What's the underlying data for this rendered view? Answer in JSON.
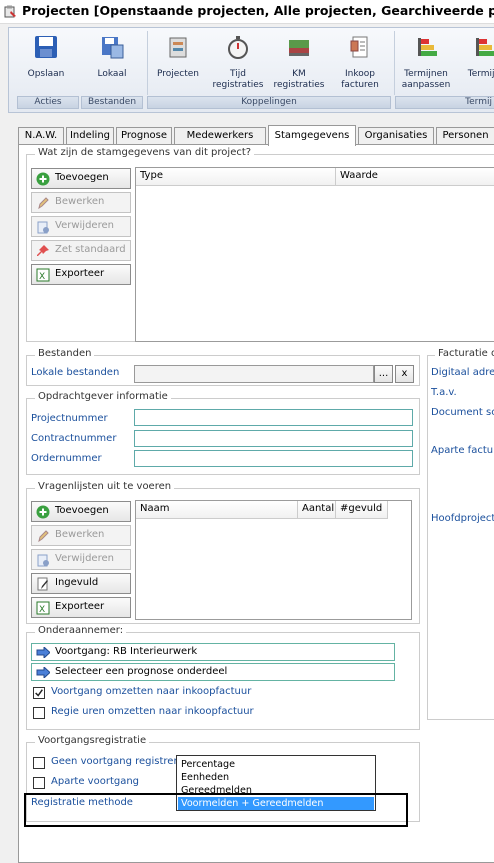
{
  "window": {
    "title": "Projecten [Openstaande projecten, Alle projecten, Gearchiveerde proje"
  },
  "ribbon": {
    "buttons": [
      {
        "label": "Opslaan",
        "icon": "floppy-disk-icon"
      },
      {
        "label": "Lokaal",
        "icon": "local-save-icon"
      },
      {
        "label": "Projecten",
        "icon": "projects-icon"
      },
      {
        "label": "Tijd registraties",
        "icon": "stopwatch-icon"
      },
      {
        "label": "KM registraties",
        "icon": "car-icon"
      },
      {
        "label": "Inkoop facturen",
        "icon": "invoice-icon"
      },
      {
        "label": "Termijnen aanpassen",
        "icon": "chart-bars-icon"
      },
      {
        "label": "Termijn",
        "icon": "chart-bars-icon"
      }
    ],
    "groups": [
      "Acties",
      "Bestanden",
      "Koppelingen",
      "Termij"
    ]
  },
  "tabs": [
    "N.A.W.",
    "Indeling",
    "Prognose",
    "Medewerkers",
    "Stamgegevens",
    "Organisaties",
    "Personen"
  ],
  "active_tab": "Stamgegevens",
  "stamgegevens": {
    "legend": "Wat zijn de stamgegevens van dit project?",
    "buttons": [
      "Toevoegen",
      "Bewerken",
      "Verwijderen",
      "Zet standaard",
      "Exporteer"
    ],
    "columns": [
      "Type",
      "Waarde"
    ]
  },
  "bestanden": {
    "legend": "Bestanden",
    "label": "Lokale bestanden",
    "browse": "...",
    "clear": "x"
  },
  "opdrachtgever": {
    "legend": "Opdrachtgever informatie",
    "fields": [
      "Projectnummer",
      "Contractnummer",
      "Ordernummer"
    ]
  },
  "vragenlijsten": {
    "legend": "Vragenlijsten uit te voeren",
    "buttons": [
      "Toevoegen",
      "Bewerken",
      "Verwijderen",
      "Ingevuld",
      "Exporteer"
    ],
    "columns": [
      "Naam",
      "Aantal",
      "#gevuld"
    ]
  },
  "onderaannemer": {
    "legend": "Onderaannemer:",
    "voortgang": "Voortgang: RB Interieurwerk",
    "prognose": "Selecteer een prognose onderdeel",
    "check1": {
      "label": "Voortgang omzetten naar inkoopfactuur",
      "checked": true
    },
    "check2": {
      "label": "Regie uren omzetten naar inkoopfactuur",
      "checked": false
    }
  },
  "voortgangsregistratie": {
    "legend": "Voortgangsregistratie",
    "check1": "Geen voortgang registreren",
    "check2": "Aparte voortgang",
    "label": "Registratie methode",
    "options": [
      "Percentage",
      "Eenheden",
      "Gereedmelden",
      "Voormelden + Gereedmelden"
    ],
    "selected": "Voormelden + Gereedmelden"
  },
  "facturatie": {
    "legend": "Facturatie o",
    "labels": [
      "Digitaal adres",
      "T.a.v.",
      "Document sch",
      "Aparte factu",
      "Hoofdproject"
    ]
  },
  "colors": {
    "link": "#1a4f9c",
    "field_border": "#5eaaa9",
    "selected": "#3399ff"
  }
}
